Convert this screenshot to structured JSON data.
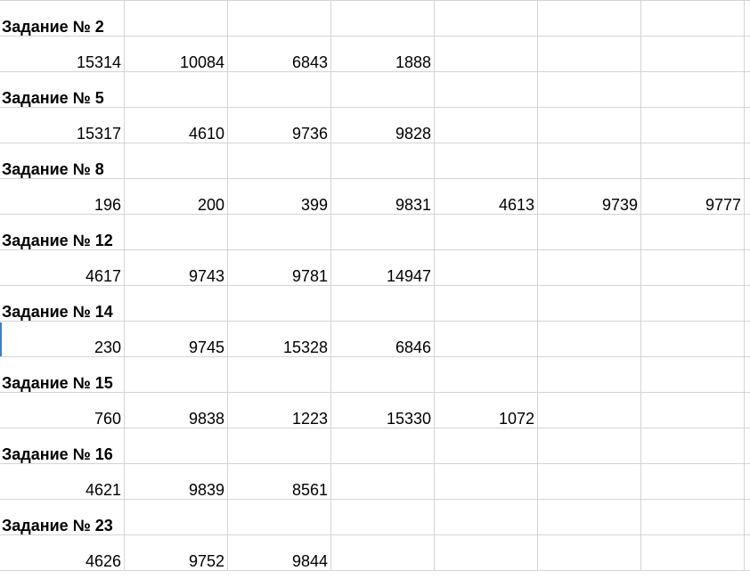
{
  "sheet": {
    "rows": [
      {
        "label": "Задание № 2",
        "values": [
          "15314",
          "10084",
          "6843",
          "1888"
        ]
      },
      {
        "label": "Задание № 5",
        "values": [
          "15317",
          "4610",
          "9736",
          "9828"
        ]
      },
      {
        "label": "Задание № 8",
        "values": [
          "196",
          "200",
          "399",
          "9831",
          "4613",
          "9739",
          "9777"
        ]
      },
      {
        "label": "Задание № 12",
        "values": [
          "4617",
          "9743",
          "9781",
          "14947"
        ]
      },
      {
        "label": "Задание № 14",
        "values": [
          "230",
          "9745",
          "15328",
          "6846"
        ]
      },
      {
        "label": "Задание № 15",
        "values": [
          "760",
          "9838",
          "1223",
          "15330",
          "1072"
        ]
      },
      {
        "label": "Задание № 16",
        "values": [
          "4621",
          "9839",
          "8561"
        ]
      },
      {
        "label": "Задание № 23",
        "values": [
          "4626",
          "9752",
          "9844"
        ]
      }
    ]
  }
}
